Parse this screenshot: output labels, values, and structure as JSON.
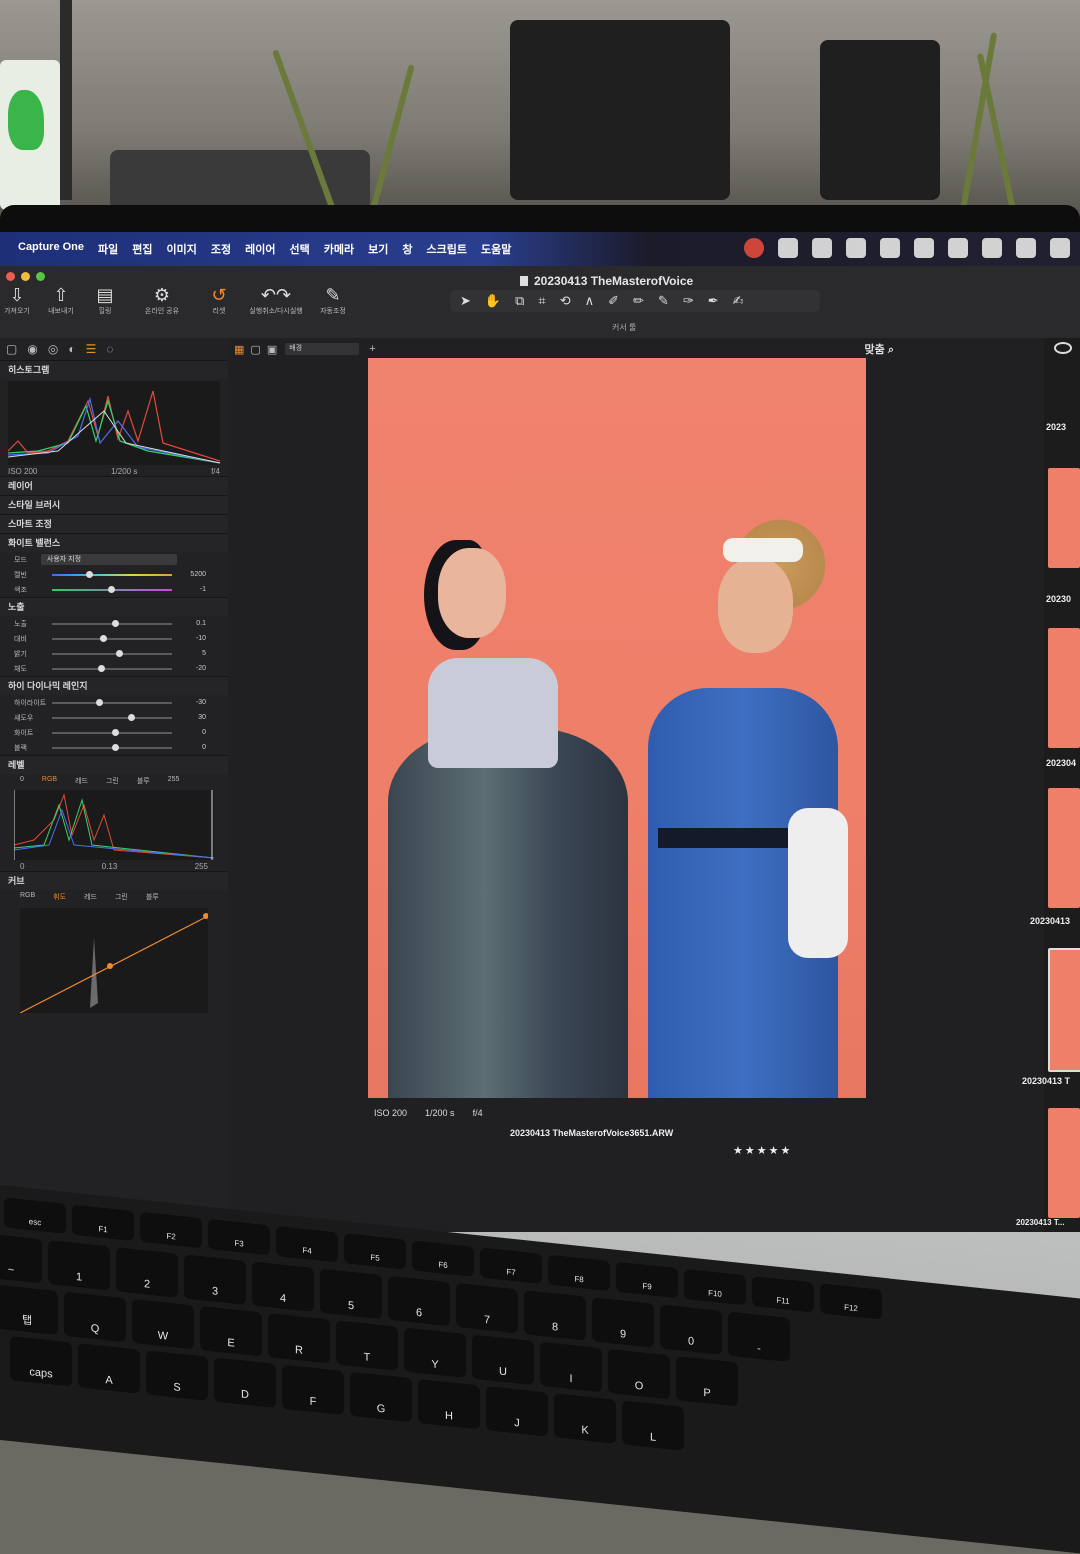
{
  "menubar": {
    "items": [
      "Capture One",
      "파일",
      "편집",
      "이미지",
      "조정",
      "레이어",
      "선택",
      "카메라",
      "보기",
      "창",
      "스크립트",
      "도움말"
    ]
  },
  "window": {
    "title": "20230413 TheMasterofVoice"
  },
  "toolbar": {
    "left_buttons": [
      {
        "icon": "import-icon",
        "label": "가져오기"
      },
      {
        "icon": "export-icon",
        "label": "내보내기"
      },
      {
        "icon": "batch-icon",
        "label": "힐링"
      },
      {
        "icon": "tether-icon",
        "label": "온라인 공유"
      },
      {
        "icon": "reset-icon",
        "label": "리셋"
      },
      {
        "icon": "undo-icon",
        "label": "실행취소/다시실행"
      },
      {
        "icon": "auto-adjust-icon",
        "label": "자동조정"
      }
    ],
    "cursor_label": "커서 툴"
  },
  "left_panel": {
    "histogram_title": "히스토그램",
    "histogram_meta": {
      "iso": "ISO 200",
      "shutter": "1/200 s",
      "aperture": "f/4"
    },
    "layers_title": "레이어",
    "style_brush_title": "스타일 브러시",
    "smart_adjust_title": "스마트 조정",
    "white_balance": {
      "title": "화이트 밸런스",
      "mode_label": "모드",
      "mode_value": "사용자 지정",
      "rows": [
        {
          "label": "캘빈",
          "value": "5200"
        },
        {
          "label": "색조",
          "value": "-1"
        }
      ]
    },
    "exposure": {
      "title": "노출",
      "rows": [
        {
          "label": "노출",
          "value": "0.1"
        },
        {
          "label": "대비",
          "value": "-10"
        },
        {
          "label": "밝기",
          "value": "5"
        },
        {
          "label": "채도",
          "value": "-20"
        }
      ]
    },
    "hdr": {
      "title": "하이 다이나믹 레인지",
      "rows": [
        {
          "label": "하이라이트",
          "value": "-30"
        },
        {
          "label": "섀도우",
          "value": "30"
        },
        {
          "label": "화이트",
          "value": "0"
        },
        {
          "label": "블랙",
          "value": "0"
        }
      ]
    },
    "levels": {
      "title": "레벨",
      "tabs": [
        "RGB",
        "레드",
        "그린",
        "블루"
      ],
      "active_tab": "RGB",
      "low": "0",
      "high": "255",
      "mid": "0.13",
      "out_low": "0",
      "out_high": "255"
    },
    "curve": {
      "title": "커브",
      "tabs": [
        "RGB",
        "휘도",
        "레드",
        "그린",
        "블루"
      ],
      "active_tab": "휘도"
    }
  },
  "viewer": {
    "background_select": "배경",
    "fit_label": "맞춤",
    "photo_meta": {
      "iso": "ISO 200",
      "shutter": "1/200 s",
      "aperture": "f/4"
    },
    "filename": "20230413 TheMasterofVoice3651.ARW",
    "rating": "★★★★★"
  },
  "browser": {
    "captions": [
      "2023",
      "20230",
      "202304",
      "20230413",
      "20230413 T",
      "20230413 T..."
    ]
  },
  "keyboard": {
    "fn_row": [
      "esc",
      "F1",
      "F2",
      "F3",
      "F4",
      "F5",
      "F6",
      "F7",
      "F8",
      "F9",
      "F10",
      "F11",
      "F12"
    ],
    "num_row": [
      "~",
      "1",
      "2",
      "3",
      "4",
      "5",
      "6",
      "7",
      "8",
      "9",
      "0",
      "-"
    ],
    "q_row": [
      "탭",
      "Q",
      "W",
      "E",
      "R",
      "T",
      "Y",
      "U",
      "I",
      "O",
      "P"
    ],
    "a_row": [
      "caps",
      "A",
      "S",
      "D",
      "F",
      "G",
      "H",
      "J",
      "K",
      "L"
    ]
  },
  "colors": {
    "accent": "#ef8a2e",
    "backdrop": "#ee7f69",
    "menubar": "#2a3e8e"
  }
}
